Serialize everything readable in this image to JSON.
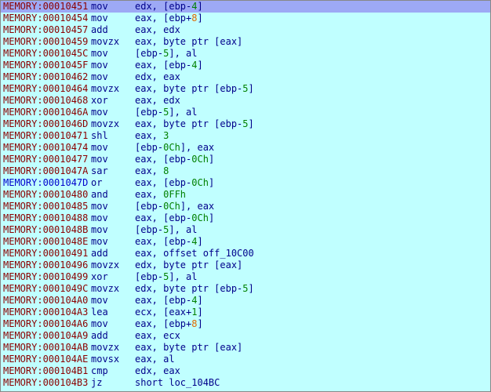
{
  "listing": {
    "rows": [
      {
        "addr": "MEMORY:00010451",
        "mn": "mov",
        "ops": [
          [
            "edx, [ebp-",
            ""
          ],
          [
            "4",
            "num"
          ],
          [
            "]",
            ""
          ]
        ],
        "selected": true
      },
      {
        "addr": "MEMORY:00010454",
        "mn": "mov",
        "ops": [
          [
            "eax, [ebp+",
            ""
          ],
          [
            "8",
            "orange"
          ],
          [
            "]",
            ""
          ]
        ]
      },
      {
        "addr": "MEMORY:00010457",
        "mn": "add",
        "ops": [
          [
            "eax, edx",
            ""
          ]
        ]
      },
      {
        "addr": "MEMORY:00010459",
        "mn": "movzx",
        "ops": [
          [
            "eax, byte ptr [eax]",
            ""
          ]
        ]
      },
      {
        "addr": "MEMORY:0001045C",
        "mn": "mov",
        "ops": [
          [
            "[ebp-",
            ""
          ],
          [
            "5",
            "num"
          ],
          [
            "], al",
            ""
          ]
        ]
      },
      {
        "addr": "MEMORY:0001045F",
        "mn": "mov",
        "ops": [
          [
            "eax, [ebp-",
            ""
          ],
          [
            "4",
            "num"
          ],
          [
            "]",
            ""
          ]
        ]
      },
      {
        "addr": "MEMORY:00010462",
        "mn": "mov",
        "ops": [
          [
            "edx, eax",
            ""
          ]
        ]
      },
      {
        "addr": "MEMORY:00010464",
        "mn": "movzx",
        "ops": [
          [
            "eax, byte ptr [ebp-",
            ""
          ],
          [
            "5",
            "num"
          ],
          [
            "]",
            ""
          ]
        ]
      },
      {
        "addr": "MEMORY:00010468",
        "mn": "xor",
        "ops": [
          [
            "eax, edx",
            ""
          ]
        ]
      },
      {
        "addr": "MEMORY:0001046A",
        "mn": "mov",
        "ops": [
          [
            "[ebp-",
            ""
          ],
          [
            "5",
            "num"
          ],
          [
            "], al",
            ""
          ]
        ]
      },
      {
        "addr": "MEMORY:0001046D",
        "mn": "movzx",
        "ops": [
          [
            "eax, byte ptr [ebp-",
            ""
          ],
          [
            "5",
            "num"
          ],
          [
            "]",
            ""
          ]
        ]
      },
      {
        "addr": "MEMORY:00010471",
        "mn": "shl",
        "ops": [
          [
            "eax, ",
            ""
          ],
          [
            "3",
            "num"
          ]
        ]
      },
      {
        "addr": "MEMORY:00010474",
        "mn": "mov",
        "ops": [
          [
            "[ebp-",
            ""
          ],
          [
            "0Ch",
            "num"
          ],
          [
            "], eax",
            ""
          ]
        ]
      },
      {
        "addr": "MEMORY:00010477",
        "mn": "mov",
        "ops": [
          [
            "eax, [ebp-",
            ""
          ],
          [
            "0Ch",
            "num"
          ],
          [
            "]",
            ""
          ]
        ]
      },
      {
        "addr": "MEMORY:0001047A",
        "mn": "sar",
        "ops": [
          [
            "eax, ",
            ""
          ],
          [
            "8",
            "num"
          ]
        ]
      },
      {
        "addr": "MEMORY:0001047D",
        "mn": "or",
        "ops": [
          [
            "eax, [ebp-",
            ""
          ],
          [
            "0Ch",
            "num"
          ],
          [
            "]",
            ""
          ]
        ],
        "blue": true
      },
      {
        "addr": "MEMORY:00010480",
        "mn": "and",
        "ops": [
          [
            "eax, ",
            ""
          ],
          [
            "0FFh",
            "num"
          ]
        ]
      },
      {
        "addr": "MEMORY:00010485",
        "mn": "mov",
        "ops": [
          [
            "[ebp-",
            ""
          ],
          [
            "0Ch",
            "num"
          ],
          [
            "], eax",
            ""
          ]
        ]
      },
      {
        "addr": "MEMORY:00010488",
        "mn": "mov",
        "ops": [
          [
            "eax, [ebp-",
            ""
          ],
          [
            "0Ch",
            "num"
          ],
          [
            "]",
            ""
          ]
        ]
      },
      {
        "addr": "MEMORY:0001048B",
        "mn": "mov",
        "ops": [
          [
            "[ebp-",
            ""
          ],
          [
            "5",
            "num"
          ],
          [
            "], al",
            ""
          ]
        ]
      },
      {
        "addr": "MEMORY:0001048E",
        "mn": "mov",
        "ops": [
          [
            "eax, [ebp-",
            ""
          ],
          [
            "4",
            "num"
          ],
          [
            "]",
            ""
          ]
        ]
      },
      {
        "addr": "MEMORY:00010491",
        "mn": "add",
        "ops": [
          [
            "eax, offset off_10C00",
            ""
          ]
        ]
      },
      {
        "addr": "MEMORY:00010496",
        "mn": "movzx",
        "ops": [
          [
            "edx, byte ptr [eax]",
            ""
          ]
        ]
      },
      {
        "addr": "MEMORY:00010499",
        "mn": "xor",
        "ops": [
          [
            "[ebp-",
            ""
          ],
          [
            "5",
            "num"
          ],
          [
            "], al",
            ""
          ]
        ]
      },
      {
        "addr": "MEMORY:0001049C",
        "mn": "movzx",
        "ops": [
          [
            "edx, byte ptr [ebp-",
            ""
          ],
          [
            "5",
            "num"
          ],
          [
            "]",
            ""
          ]
        ]
      },
      {
        "addr": "MEMORY:000104A0",
        "mn": "mov",
        "ops": [
          [
            "eax, [ebp-",
            ""
          ],
          [
            "4",
            "num"
          ],
          [
            "]",
            ""
          ]
        ]
      },
      {
        "addr": "MEMORY:000104A3",
        "mn": "lea",
        "ops": [
          [
            "ecx, [eax+",
            ""
          ],
          [
            "1",
            "num"
          ],
          [
            "]",
            ""
          ]
        ]
      },
      {
        "addr": "MEMORY:000104A6",
        "mn": "mov",
        "ops": [
          [
            "eax, [ebp+",
            ""
          ],
          [
            "8",
            "orange"
          ],
          [
            "]",
            ""
          ]
        ]
      },
      {
        "addr": "MEMORY:000104A9",
        "mn": "add",
        "ops": [
          [
            "eax, ecx",
            ""
          ]
        ]
      },
      {
        "addr": "MEMORY:000104AB",
        "mn": "movzx",
        "ops": [
          [
            "eax, byte ptr [eax]",
            ""
          ]
        ]
      },
      {
        "addr": "MEMORY:000104AE",
        "mn": "movsx",
        "ops": [
          [
            "eax, al",
            ""
          ]
        ]
      },
      {
        "addr": "MEMORY:000104B1",
        "mn": "cmp",
        "ops": [
          [
            "edx, eax",
            ""
          ]
        ]
      },
      {
        "addr": "MEMORY:000104B3",
        "mn": "jz",
        "ops": [
          [
            "short loc_104BC",
            ""
          ]
        ]
      }
    ]
  }
}
